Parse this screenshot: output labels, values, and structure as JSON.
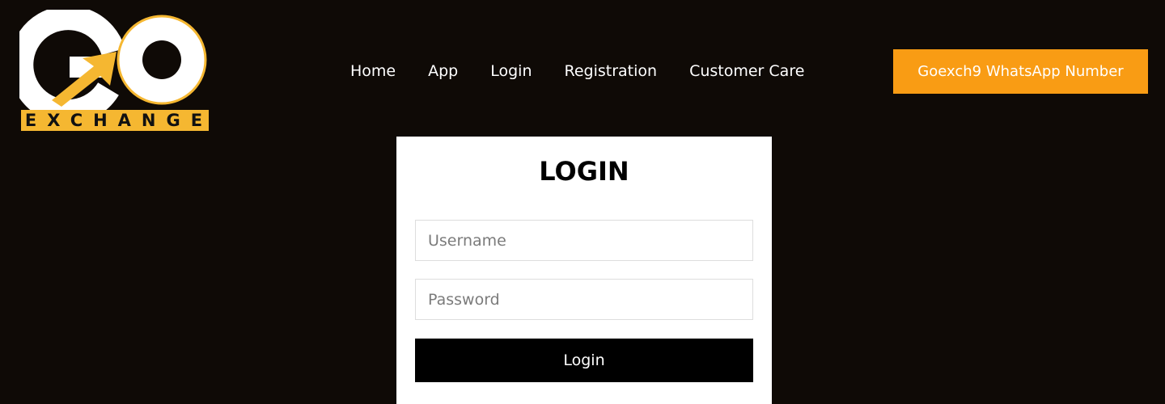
{
  "logo": {
    "letters": "GO",
    "band_text": "EXCHANGE",
    "icon": "arrow-up-right-icon"
  },
  "nav": {
    "items": [
      {
        "label": "Home"
      },
      {
        "label": "App"
      },
      {
        "label": "Login"
      },
      {
        "label": "Registration"
      },
      {
        "label": "Customer Care"
      }
    ]
  },
  "cta": {
    "label": "Goexch9 WhatsApp Number"
  },
  "login": {
    "title": "LOGIN",
    "username_placeholder": "Username",
    "username_value": "",
    "password_placeholder": "Password",
    "password_value": "",
    "submit_label": "Login"
  },
  "colors": {
    "background": "#0f0a06",
    "accent": "#f99c14",
    "logo_gold": "#f5b731",
    "card": "#ffffff",
    "button": "#000000"
  }
}
